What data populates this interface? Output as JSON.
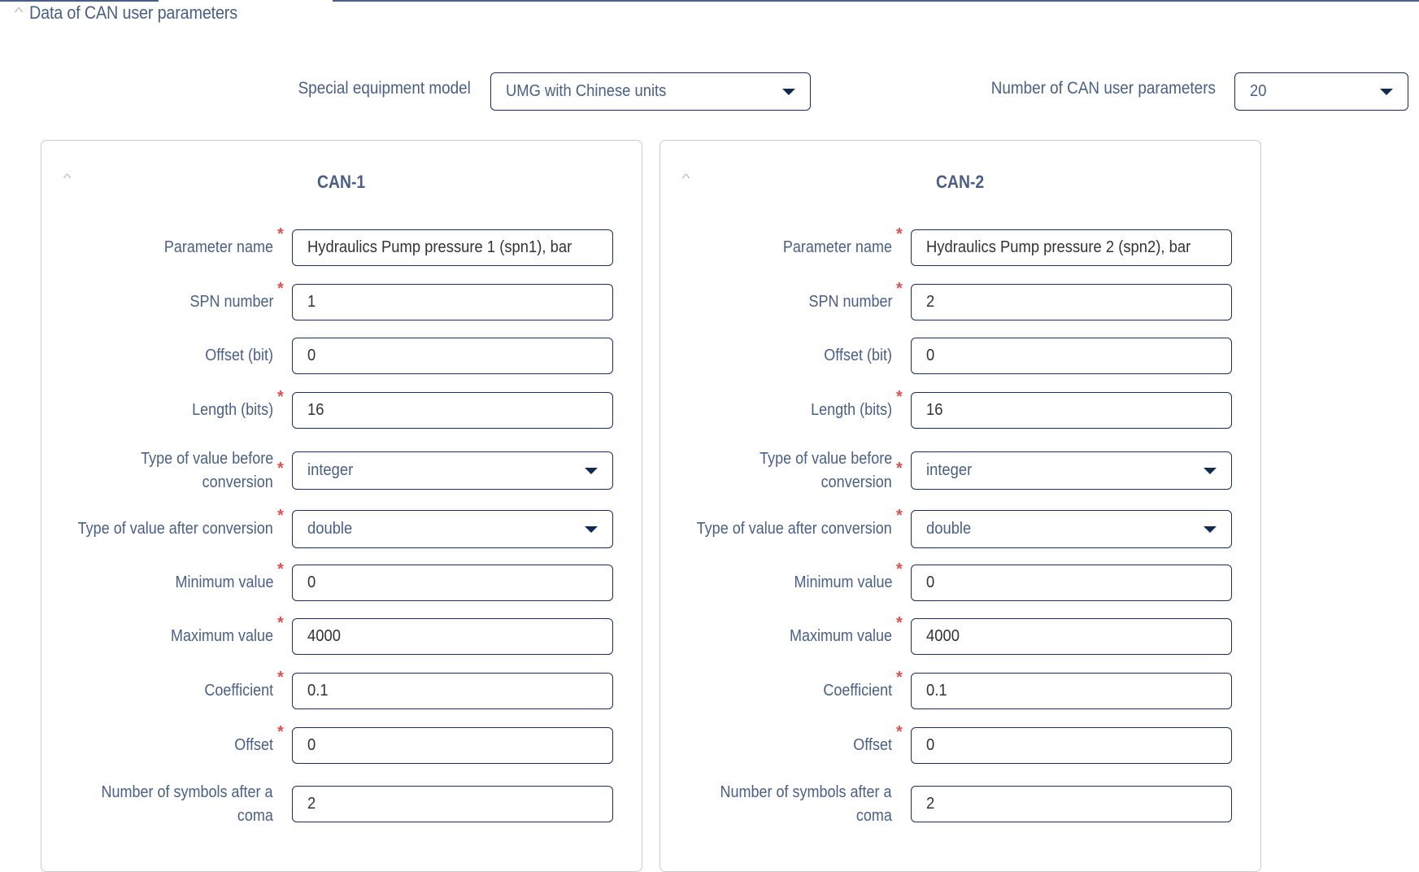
{
  "section": {
    "title": "Data of CAN user parameters",
    "collapse_icon": "chevron-up-icon"
  },
  "top_controls": {
    "equipment_model": {
      "label": "Special equipment model",
      "value": "UMG with Chinese units"
    },
    "param_count": {
      "label": "Number of CAN user parameters",
      "value": "20"
    }
  },
  "colors": {
    "accent": "#4a5f85",
    "border": "#1a2f55",
    "required": "#e05050"
  },
  "cards": [
    {
      "title": "CAN-1",
      "fields": [
        {
          "label": "Parameter name",
          "required": true,
          "type": "input",
          "value": "Hydraulics Pump pressure 1 (spn1), bar"
        },
        {
          "label": "SPN number",
          "required": true,
          "type": "input",
          "value": "1"
        },
        {
          "label": "Offset (bit)",
          "required": false,
          "type": "input",
          "value": "0"
        },
        {
          "label": "Length (bits)",
          "required": true,
          "type": "input",
          "value": "16"
        },
        {
          "label": "Type of value before conversion",
          "label_lines": [
            "Type of value before",
            "conversion"
          ],
          "required": true,
          "type": "select",
          "value": "integer"
        },
        {
          "label": "Type of value after conversion",
          "required": true,
          "type": "select",
          "value": "double"
        },
        {
          "label": "Minimum value",
          "required": true,
          "type": "input",
          "value": "0"
        },
        {
          "label": "Maximum value",
          "required": true,
          "type": "input",
          "value": "4000"
        },
        {
          "label": "Coefficient",
          "required": true,
          "type": "input",
          "value": "0.1"
        },
        {
          "label": "Offset",
          "required": true,
          "type": "input",
          "value": "0"
        },
        {
          "label": "Number of symbols after a coma",
          "label_lines": [
            "Number of symbols after a",
            "coma"
          ],
          "required": false,
          "type": "input",
          "value": "2"
        }
      ]
    },
    {
      "title": "CAN-2",
      "fields": [
        {
          "label": "Parameter name",
          "required": true,
          "type": "input",
          "value": "Hydraulics Pump pressure 2 (spn2), bar"
        },
        {
          "label": "SPN number",
          "required": true,
          "type": "input",
          "value": "2"
        },
        {
          "label": "Offset (bit)",
          "required": false,
          "type": "input",
          "value": "0"
        },
        {
          "label": "Length (bits)",
          "required": true,
          "type": "input",
          "value": "16"
        },
        {
          "label": "Type of value before conversion",
          "label_lines": [
            "Type of value before",
            "conversion"
          ],
          "required": true,
          "type": "select",
          "value": "integer"
        },
        {
          "label": "Type of value after conversion",
          "required": true,
          "type": "select",
          "value": "double"
        },
        {
          "label": "Minimum value",
          "required": true,
          "type": "input",
          "value": "0"
        },
        {
          "label": "Maximum value",
          "required": true,
          "type": "input",
          "value": "4000"
        },
        {
          "label": "Coefficient",
          "required": true,
          "type": "input",
          "value": "0.1"
        },
        {
          "label": "Offset",
          "required": true,
          "type": "input",
          "value": "0"
        },
        {
          "label": "Number of symbols after a coma",
          "label_lines": [
            "Number of symbols after a",
            "coma"
          ],
          "required": false,
          "type": "input",
          "value": "2"
        }
      ]
    }
  ]
}
